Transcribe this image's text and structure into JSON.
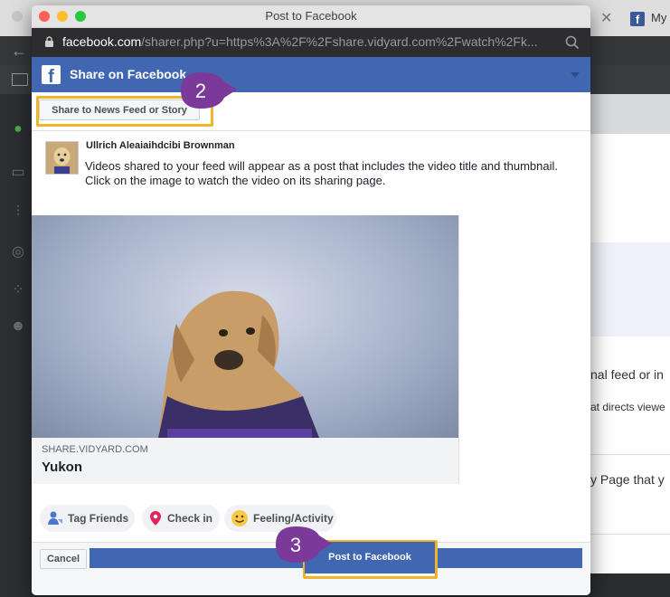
{
  "background": {
    "tab": {
      "label": "My"
    },
    "content_snippets": [
      "nal feed or in",
      "at directs viewe",
      "y Page that y"
    ]
  },
  "popup": {
    "window_title": "Post to Facebook",
    "url": {
      "host": "facebook.com",
      "path": "/sharer.php?u=https%3A%2F%2Fshare.vidyard.com%2Fwatch%2Fk..."
    },
    "header": {
      "title": "Share on Facebook"
    },
    "share_target_label": "Share to News Feed or Story",
    "user_name": "Ullrich Aleaiaihdcibi Brownman",
    "post_text_line1": "Videos shared to your feed will appear as a post that includes the video title and thumbnail.",
    "post_text_line2": "Click on the image to watch the video on its sharing page.",
    "preview": {
      "domain": "SHARE.VIDYARD.COM",
      "title": "Yukon"
    },
    "actions": [
      {
        "label": "Tag Friends",
        "icon": "tag-friends-icon"
      },
      {
        "label": "Check in",
        "icon": "location-pin-icon"
      },
      {
        "label": "Feeling/Activity",
        "icon": "smiley-icon"
      }
    ],
    "cancel_label": "Cancel",
    "post_label": "Post to Facebook"
  },
  "callouts": [
    {
      "number": "2"
    },
    {
      "number": "3"
    }
  ],
  "colors": {
    "facebook_blue": "#4267b2",
    "highlight": "#f0b428",
    "callout": "#7b3a9a"
  }
}
